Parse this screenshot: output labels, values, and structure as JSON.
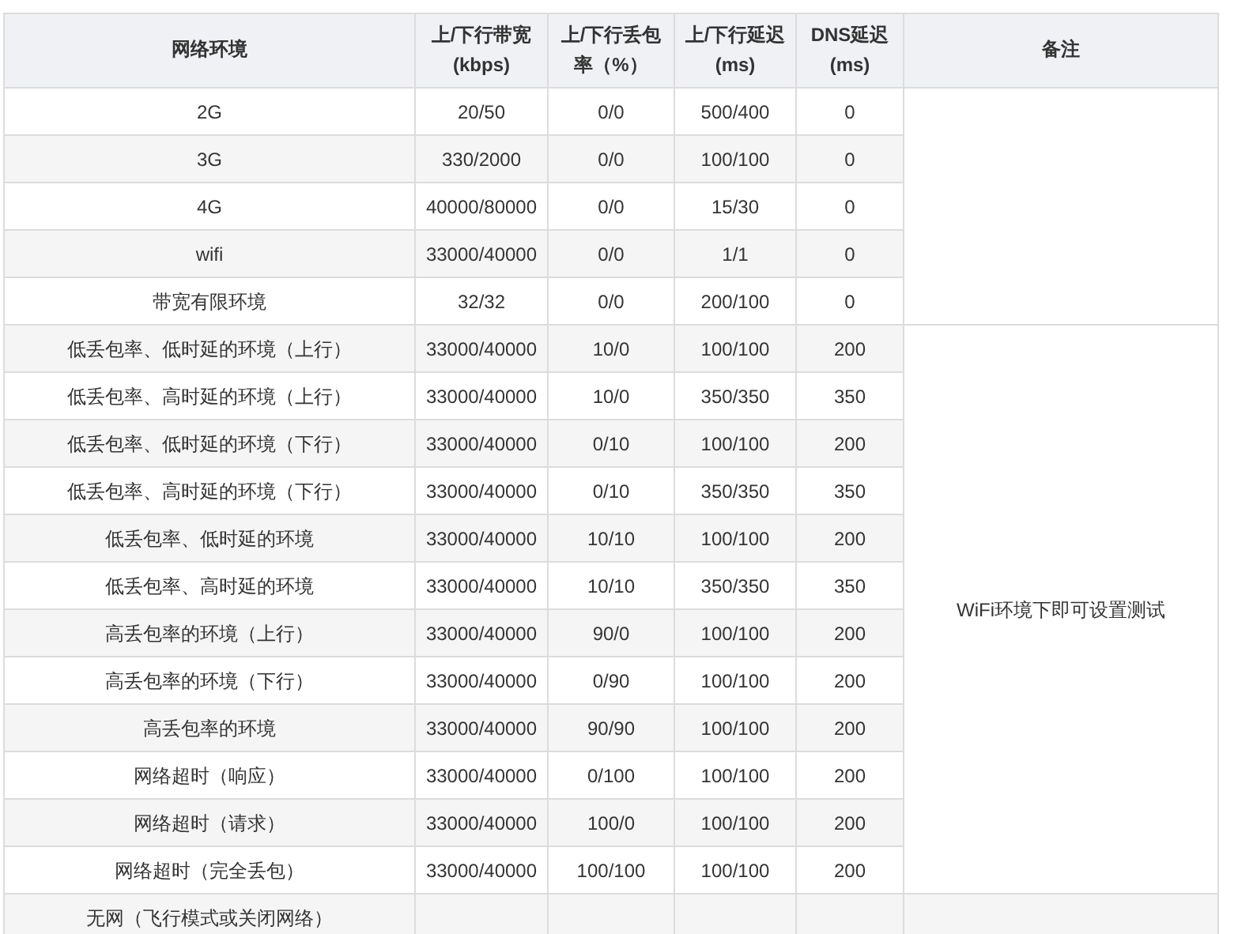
{
  "table": {
    "columns": [
      "网络环境",
      "上/下行带宽 (kbps)",
      "上/下行丢包率（%）",
      "上/下行延迟 (ms)",
      "DNS延迟 (ms)",
      "备注"
    ],
    "groups": [
      {
        "rows": [
          {
            "cells": [
              "2G",
              "20/50",
              "0/0",
              "500/400",
              "0"
            ]
          },
          {
            "cells": [
              "3G",
              "330/2000",
              "0/0",
              "100/100",
              "0"
            ]
          },
          {
            "cells": [
              "4G",
              "40000/80000",
              "0/0",
              "15/30",
              "0"
            ]
          },
          {
            "cells": [
              "wifi",
              "33000/40000",
              "0/0",
              "1/1",
              "0"
            ]
          },
          {
            "cells": [
              "带宽有限环境",
              "32/32",
              "0/0",
              "200/100",
              "0"
            ]
          }
        ]
      },
      {
        "remark": "WiFi环境下即可设置测试",
        "rows": [
          {
            "cells": [
              "低丢包率、低时延的环境（上行）",
              "33000/40000",
              "10/0",
              "100/100",
              "200"
            ]
          },
          {
            "cells": [
              "低丢包率、高时延的环境（上行）",
              "33000/40000",
              "10/0",
              "350/350",
              "350"
            ]
          },
          {
            "cells": [
              "低丢包率、低时延的环境（下行）",
              "33000/40000",
              "0/10",
              "100/100",
              "200"
            ]
          },
          {
            "cells": [
              "低丢包率、高时延的环境（下行）",
              "33000/40000",
              "0/10",
              "350/350",
              "350"
            ]
          },
          {
            "cells": [
              "低丢包率、低时延的环境",
              "33000/40000",
              "10/10",
              "100/100",
              "200"
            ]
          },
          {
            "cells": [
              "低丢包率、高时延的环境",
              "33000/40000",
              "10/10",
              "350/350",
              "350"
            ]
          },
          {
            "cells": [
              "高丢包率的环境（上行）",
              "33000/40000",
              "90/0",
              "100/100",
              "200"
            ]
          },
          {
            "cells": [
              "高丢包率的环境（下行）",
              "33000/40000",
              "0/90",
              "100/100",
              "200"
            ]
          },
          {
            "cells": [
              "高丢包率的环境",
              "33000/40000",
              "90/90",
              "100/100",
              "200"
            ]
          },
          {
            "cells": [
              "网络超时（响应）",
              "33000/40000",
              "0/100",
              "100/100",
              "200"
            ]
          },
          {
            "cells": [
              "网络超时（请求）",
              "33000/40000",
              "100/0",
              "100/100",
              "200"
            ]
          },
          {
            "cells": [
              "网络超时（完全丢包）",
              "33000/40000",
              "100/100",
              "100/100",
              "200"
            ]
          }
        ]
      },
      {
        "rows": [
          {
            "cells": [
              "无网（飞行模式或关闭网络）"
            ]
          }
        ]
      }
    ]
  }
}
